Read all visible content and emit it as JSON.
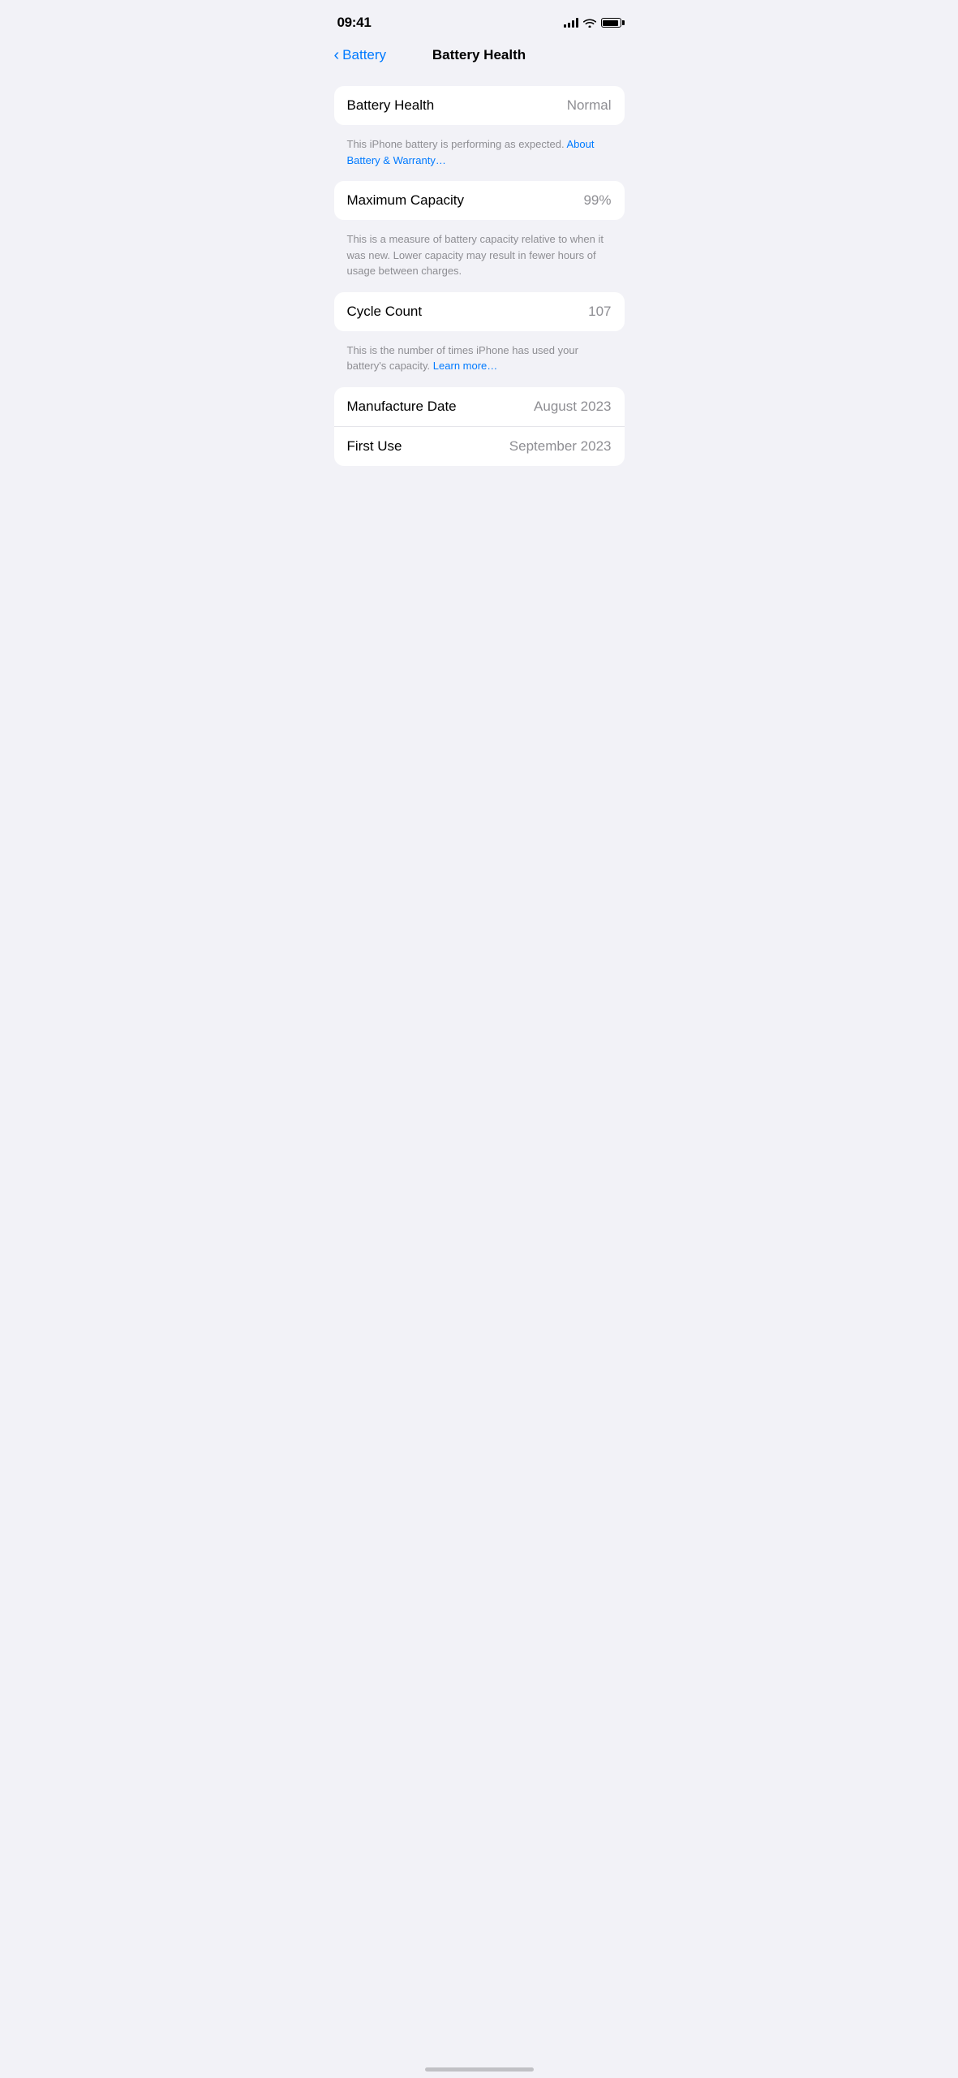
{
  "statusBar": {
    "time": "09:41",
    "battery": "full"
  },
  "navigation": {
    "backLabel": "Battery",
    "title": "Battery Health"
  },
  "sections": [
    {
      "id": "battery-health-section",
      "rows": [
        {
          "label": "Battery Health",
          "value": "Normal"
        }
      ],
      "description": "This iPhone battery is performing as expected.",
      "linkText": "About Battery & Warranty…"
    },
    {
      "id": "maximum-capacity-section",
      "rows": [
        {
          "label": "Maximum Capacity",
          "value": "99%"
        }
      ],
      "description": "This is a measure of battery capacity relative to when it was new. Lower capacity may result in fewer hours of usage between charges.",
      "linkText": null
    },
    {
      "id": "cycle-count-section",
      "rows": [
        {
          "label": "Cycle Count",
          "value": "107"
        }
      ],
      "description": "This is the number of times iPhone has used your battery's capacity.",
      "linkText": "Learn more…"
    },
    {
      "id": "dates-section",
      "rows": [
        {
          "label": "Manufacture Date",
          "value": "August 2023"
        },
        {
          "label": "First Use",
          "value": "September 2023"
        }
      ],
      "description": null,
      "linkText": null
    }
  ]
}
